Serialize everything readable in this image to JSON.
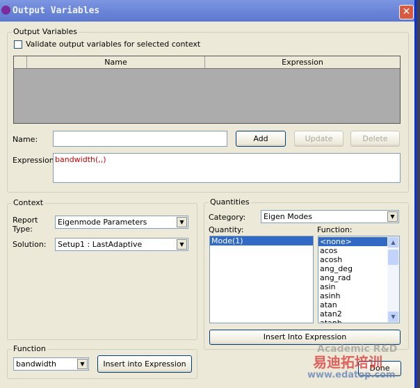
{
  "window": {
    "title": "Output Variables",
    "close": "✕"
  },
  "output_group": {
    "legend": "Output Variables",
    "validate_label": "Validate output variables for selected context",
    "columns": [
      "Name",
      "Expression"
    ],
    "name_label": "Name:",
    "name_value": "",
    "add": "Add",
    "update": "Update",
    "delete": "Delete",
    "expression_label": "Expression:",
    "expression_value": "bandwidth(,,)"
  },
  "context": {
    "legend": "Context",
    "report_type_label": "Report Type:",
    "report_type": "Eigenmode Parameters",
    "solution_label": "Solution:",
    "solution": "Setup1 : LastAdaptive"
  },
  "quantities": {
    "legend": "Quantities",
    "category_label": "Category:",
    "category": "Eigen Modes",
    "quantity_label": "Quantity:",
    "quantity_items": [
      "Mode(1)"
    ],
    "function_label": "Function:",
    "function_items": [
      "<none>",
      "acos",
      "acosh",
      "ang_deg",
      "ang_rad",
      "asin",
      "asinh",
      "atan",
      "atan2",
      "atanh"
    ],
    "insert": "Insert Into Expression"
  },
  "function": {
    "legend": "Function",
    "value": "bandwidth",
    "insert": "Insert into Expression"
  },
  "done": "Done",
  "watermark": {
    "line1": "Academic R&D",
    "line2": "易迪拓培训",
    "line3": "www.edatop.com"
  }
}
